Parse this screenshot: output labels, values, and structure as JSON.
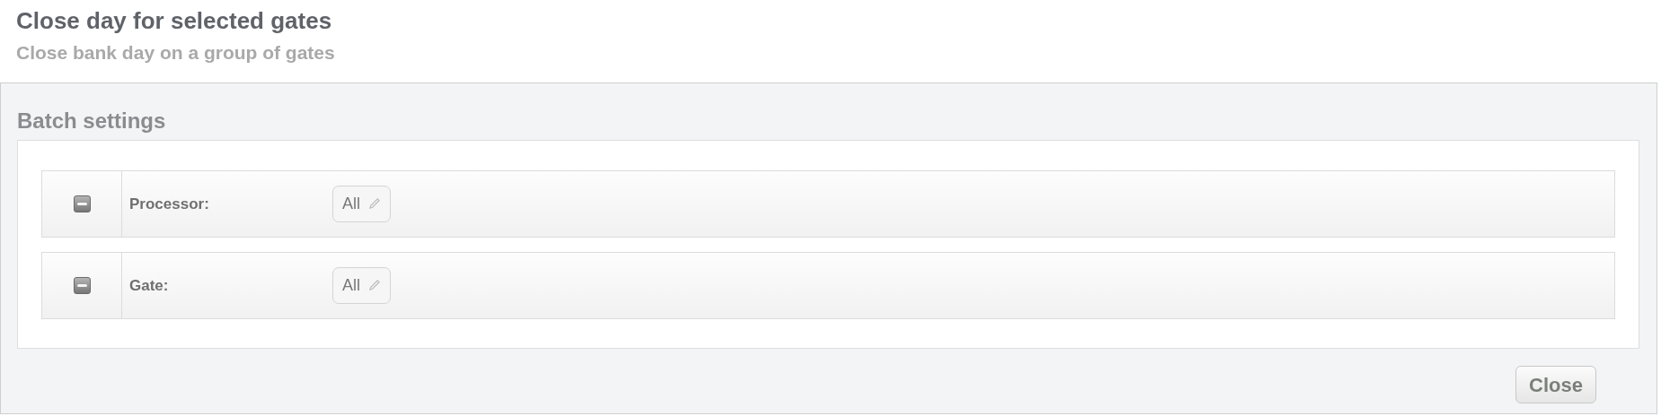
{
  "header": {
    "title": "Close day for selected gates",
    "subtitle": "Close bank day on a group of gates"
  },
  "panel": {
    "title": "Batch settings",
    "rows": [
      {
        "indeterminate": true,
        "label": "Processor:",
        "value": "All"
      },
      {
        "indeterminate": true,
        "label": "Gate:",
        "value": "All"
      }
    ]
  },
  "buttons": [
    "Close"
  ]
}
